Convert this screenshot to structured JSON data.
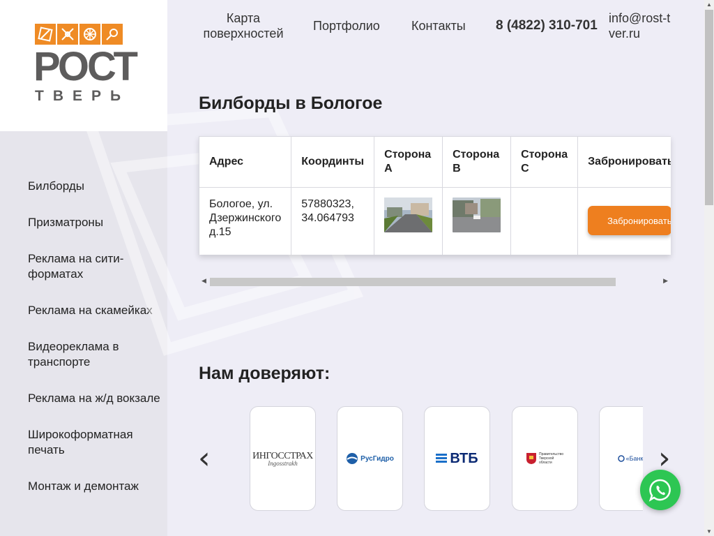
{
  "logo": {
    "main": "РОСТ",
    "sub": "ТВЕРЬ"
  },
  "sidebar": {
    "items": [
      {
        "label": "Билборды"
      },
      {
        "label": "Призматроны"
      },
      {
        "label": "Реклама на сити-форматах"
      },
      {
        "label": "Реклама на скамейках"
      },
      {
        "label": "Видеореклама в транспорте"
      },
      {
        "label": "Реклама на ж/д вокзале"
      },
      {
        "label": "Широкоформатная печать"
      },
      {
        "label": "Монтаж и демонтаж"
      }
    ]
  },
  "header": {
    "nav": [
      {
        "label": "Карта поверхностей"
      },
      {
        "label": "Портфолио"
      },
      {
        "label": "Контакты"
      }
    ],
    "phone": "8 (4822) 310-701",
    "email": "info@rost-tver.ru"
  },
  "main": {
    "title": "Билборды в Бологое",
    "table": {
      "headers": [
        "Адрес",
        "Координты",
        "Сторона А",
        "Сторона В",
        "Сторона С",
        "Забронировать"
      ],
      "rows": [
        {
          "address": "Бологое, ул. Дзержинского д.15",
          "coords": "57880323, 34.064793",
          "side_c": "",
          "book_label": "Забронировать"
        }
      ]
    },
    "partners_title": "Нам доверяют:",
    "partners": [
      {
        "name": "ИНГОССТРАХ",
        "caption": "Ingosstrakh"
      },
      {
        "name": "РусГидро"
      },
      {
        "name": "ВТБ"
      },
      {
        "name": "Правительство Тверской области"
      },
      {
        "name": "«Банк «Т"
      }
    ]
  },
  "colors": {
    "accent": "#ee7f1f",
    "whatsapp": "#2dc653",
    "bg": "#eeedf6"
  },
  "icons": [
    "chevron-left-icon",
    "chevron-right-icon",
    "whatsapp-icon"
  ]
}
